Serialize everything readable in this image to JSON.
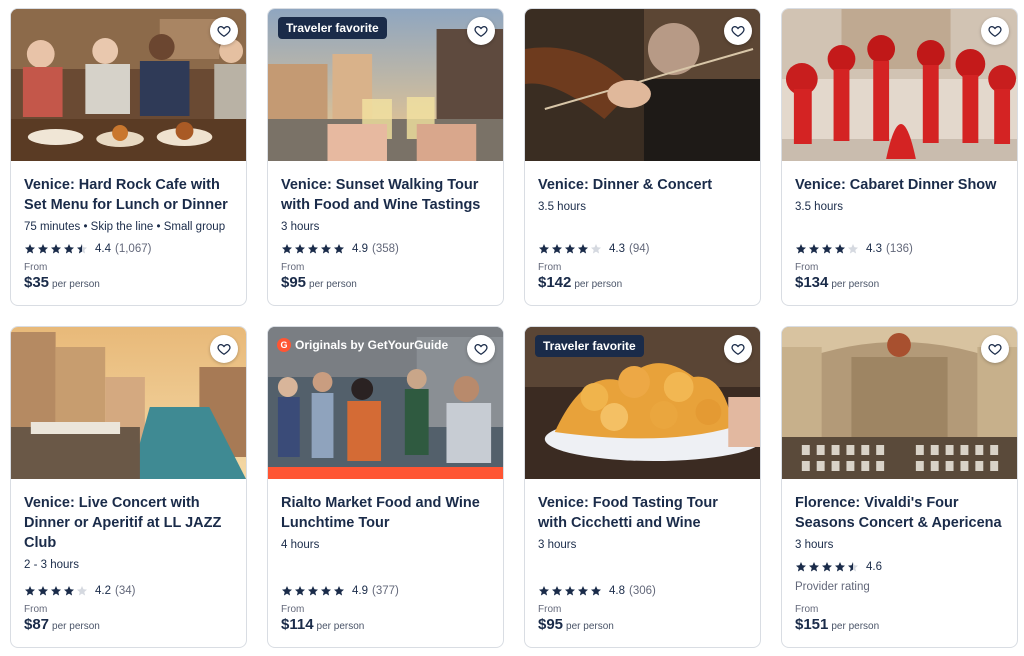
{
  "cards": [
    {
      "title": "Venice: Hard Rock Cafe with Set Menu for Lunch or Dinner",
      "meta": "75 minutes • Skip the line • Small group",
      "rating": "4.4",
      "reviews": "(1,067)",
      "stars": 4.5,
      "from": "From",
      "price": "$35",
      "per": "per person"
    },
    {
      "badge": "Traveler favorite",
      "title": "Venice: Sunset Walking Tour with Food and Wine Tastings",
      "meta": "3 hours",
      "rating": "4.9",
      "reviews": "(358)",
      "stars": 5,
      "from": "From",
      "price": "$95",
      "per": "per person"
    },
    {
      "title": "Venice: Dinner & Concert",
      "meta": "3.5 hours",
      "rating": "4.3",
      "reviews": "(94)",
      "stars": 4,
      "from": "From",
      "price": "$142",
      "per": "per person"
    },
    {
      "title": "Venice: Cabaret Dinner Show",
      "meta": "3.5 hours",
      "rating": "4.3",
      "reviews": "(136)",
      "stars": 4,
      "from": "From",
      "price": "$134",
      "per": "per person"
    },
    {
      "title": "Venice: Live Concert with Dinner or Aperitif at LL JAZZ Club",
      "meta": "2 - 3 hours",
      "rating": "4.2",
      "reviews": "(34)",
      "stars": 4,
      "from": "From",
      "price": "$87",
      "per": "per person"
    },
    {
      "originals": "Originals by GetYourGuide",
      "originals_logo": "G",
      "title": "Rialto Market Food and Wine Lunchtime Tour",
      "meta": "4 hours",
      "rating": "4.9",
      "reviews": "(377)",
      "stars": 5,
      "from": "From",
      "price": "$114",
      "per": "per person"
    },
    {
      "badge": "Traveler favorite",
      "title": "Venice: Food Tasting Tour with Cicchetti and Wine",
      "meta": "3 hours",
      "rating": "4.8",
      "reviews": "(306)",
      "stars": 5,
      "from": "From",
      "price": "$95",
      "per": "per person"
    },
    {
      "title": "Florence: Vivaldi's Four Seasons Concert & Apericena",
      "meta": "3 hours",
      "rating": "4.6",
      "reviews": "",
      "stars": 4.5,
      "provider": "Provider rating",
      "from": "From",
      "price": "$151",
      "per": "per person"
    }
  ],
  "colors": {
    "text": "#1a2b49",
    "accent": "#ff5533",
    "muted": "#63687a"
  },
  "icons": {
    "wishlist": "heart-icon",
    "rating": "star-icon"
  }
}
